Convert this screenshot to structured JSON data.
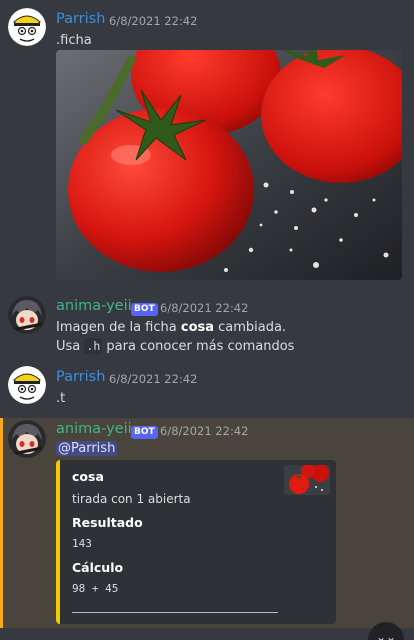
{
  "messages": [
    {
      "author": "Parrish",
      "timestamp": "6/8/2021 22:42",
      "text": ".ficha",
      "attachment": "tomato-photo"
    },
    {
      "author": "anima-yeii",
      "bot_tag": "BOT",
      "timestamp": "6/8/2021 22:42",
      "line1_pre": "Imagen de la ficha ",
      "line1_bold": "cosa",
      "line1_post": " cambiada.",
      "line2_pre": "Usa ",
      "line2_code": ".h",
      "line2_post": " para conocer más comandos"
    },
    {
      "author": "Parrish",
      "timestamp": "6/8/2021 22:42",
      "text": ".t"
    },
    {
      "author": "anima-yeii",
      "bot_tag": "BOT",
      "timestamp": "6/8/2021 22:42",
      "mention": "@Parrish",
      "embed": {
        "title": "cosa",
        "description": "tirada con 1 abierta",
        "fields": [
          {
            "name": "Resultado",
            "value": "143"
          },
          {
            "name": "Cálculo",
            "value": "98 + 45"
          }
        ],
        "accent_color": "#f0cc00"
      }
    }
  ],
  "colors": {
    "background": "#36393f",
    "parrish_name": "#3a8fde",
    "bot_name": "#43b581",
    "bot_tag": "#5865f2",
    "mention_highlight": "#49443c",
    "mention_bar": "#faa81a"
  },
  "icons": {
    "scroll_to_bottom": "chevron-down-icon"
  }
}
